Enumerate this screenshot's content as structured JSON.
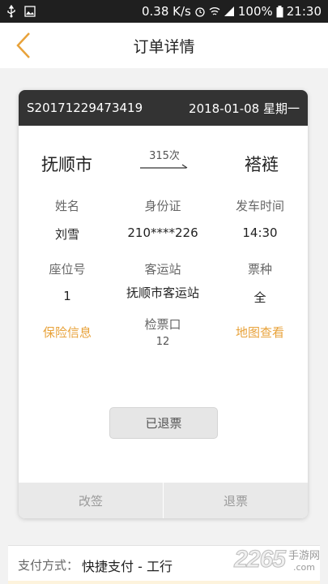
{
  "status_bar": {
    "network_speed": "0.38 K/s",
    "battery": "100%",
    "time": "21:30"
  },
  "header": {
    "title": "订单详情"
  },
  "order": {
    "number": "S20171229473419",
    "date": "2018-01-08 星期一",
    "from_city": "抚顺市",
    "to_city": "褡裢",
    "train": "315次"
  },
  "fields": {
    "name_label": "姓名",
    "name_value": "刘雪",
    "id_label": "身份证",
    "id_value": "210****226",
    "depart_label": "发车时间",
    "depart_value": "14:30",
    "seat_label": "座位号",
    "seat_value": "1",
    "station_label": "客运站",
    "station_value": "抚顺市客运站",
    "ticket_type_label": "票种",
    "ticket_type_value": "全",
    "insurance_link": "保险信息",
    "gate_label": "检票口",
    "gate_value": "12",
    "map_link": "地图查看"
  },
  "status_button": "已退票",
  "actions": {
    "change": "改签",
    "refund": "退票"
  },
  "payment": {
    "label": "支付方式：",
    "value": "快捷支付 - 工行"
  },
  "watermark": {
    "number": "2265",
    "suffix_top": "手游网",
    "suffix_bottom": ".com"
  },
  "colors": {
    "accent": "#e8a23a",
    "card_header": "#333333"
  }
}
